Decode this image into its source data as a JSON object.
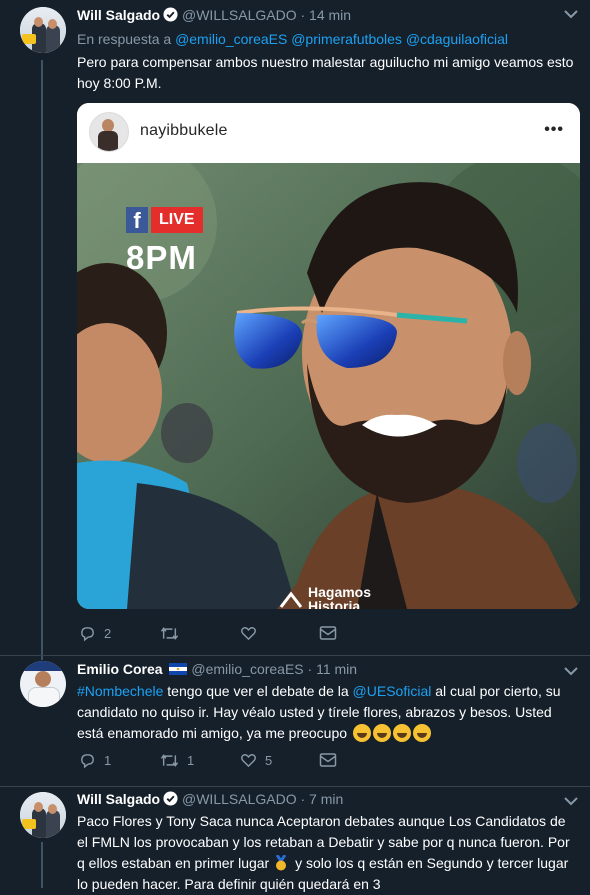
{
  "tweets": [
    {
      "name": "Will Salgado",
      "handle": "@WILLSALGADO",
      "sep": "·",
      "time": "14 min",
      "reply_prefix": "En respuesta a",
      "reply_mentions": [
        "@emilio_coreaES",
        "@primerafutboles",
        "@cdaguilaoficial"
      ],
      "text": "Pero para compensar ambos nuestro malestar aguilucho mi amigo veamos esto hoy 8:00 P.M.",
      "embed": {
        "username": "nayibbukele",
        "more": "•••",
        "fb_letter": "f",
        "live_label": "LIVE",
        "time_label": "8PM",
        "watermark_line1": "Hagamos",
        "watermark_line2": "Historia"
      },
      "actions": {
        "replies": "2",
        "retweets": "",
        "likes": ""
      }
    },
    {
      "name": "Emilio Corea",
      "handle": "@emilio_coreaES",
      "sep": "·",
      "time": "11 min",
      "hashtag": "#Nombechele",
      "text_part1": " tengo que ver el debate de la ",
      "mention": "@UESoficial",
      "text_part2": " al cual por cierto, su candidato no quiso ir. Hay véalo usted y tírele flores, abrazos y besos. Usted está enamorado mi amigo, ya me preocupo",
      "emoji_count": 4,
      "actions": {
        "replies": "1",
        "retweets": "1",
        "likes": "5"
      }
    },
    {
      "name": "Will Salgado",
      "handle": "@WILLSALGADO",
      "sep": "·",
      "time": "7 min",
      "text_part1": "Paco Flores y Tony Saca nunca Aceptaron debates aunque Los Candidatos de el FMLN los provocaban y los retaban a Debatir y sabe por q nunca fueron. Por q ellos estaban en primer lugar",
      "text_part2": " y solo los q están en Segundo y tercer lugar lo pueden hacer. Para definir quién quedará en 3"
    }
  ],
  "colors": {
    "background": "#15202b",
    "link": "#1da1f2",
    "muted": "#8899a6",
    "thread_line": "#3d5466"
  },
  "icons": [
    "verified-icon",
    "caret-down-icon",
    "reply-icon",
    "retweet-icon",
    "like-icon",
    "dm-icon",
    "el-salvador-flag-icon"
  ]
}
